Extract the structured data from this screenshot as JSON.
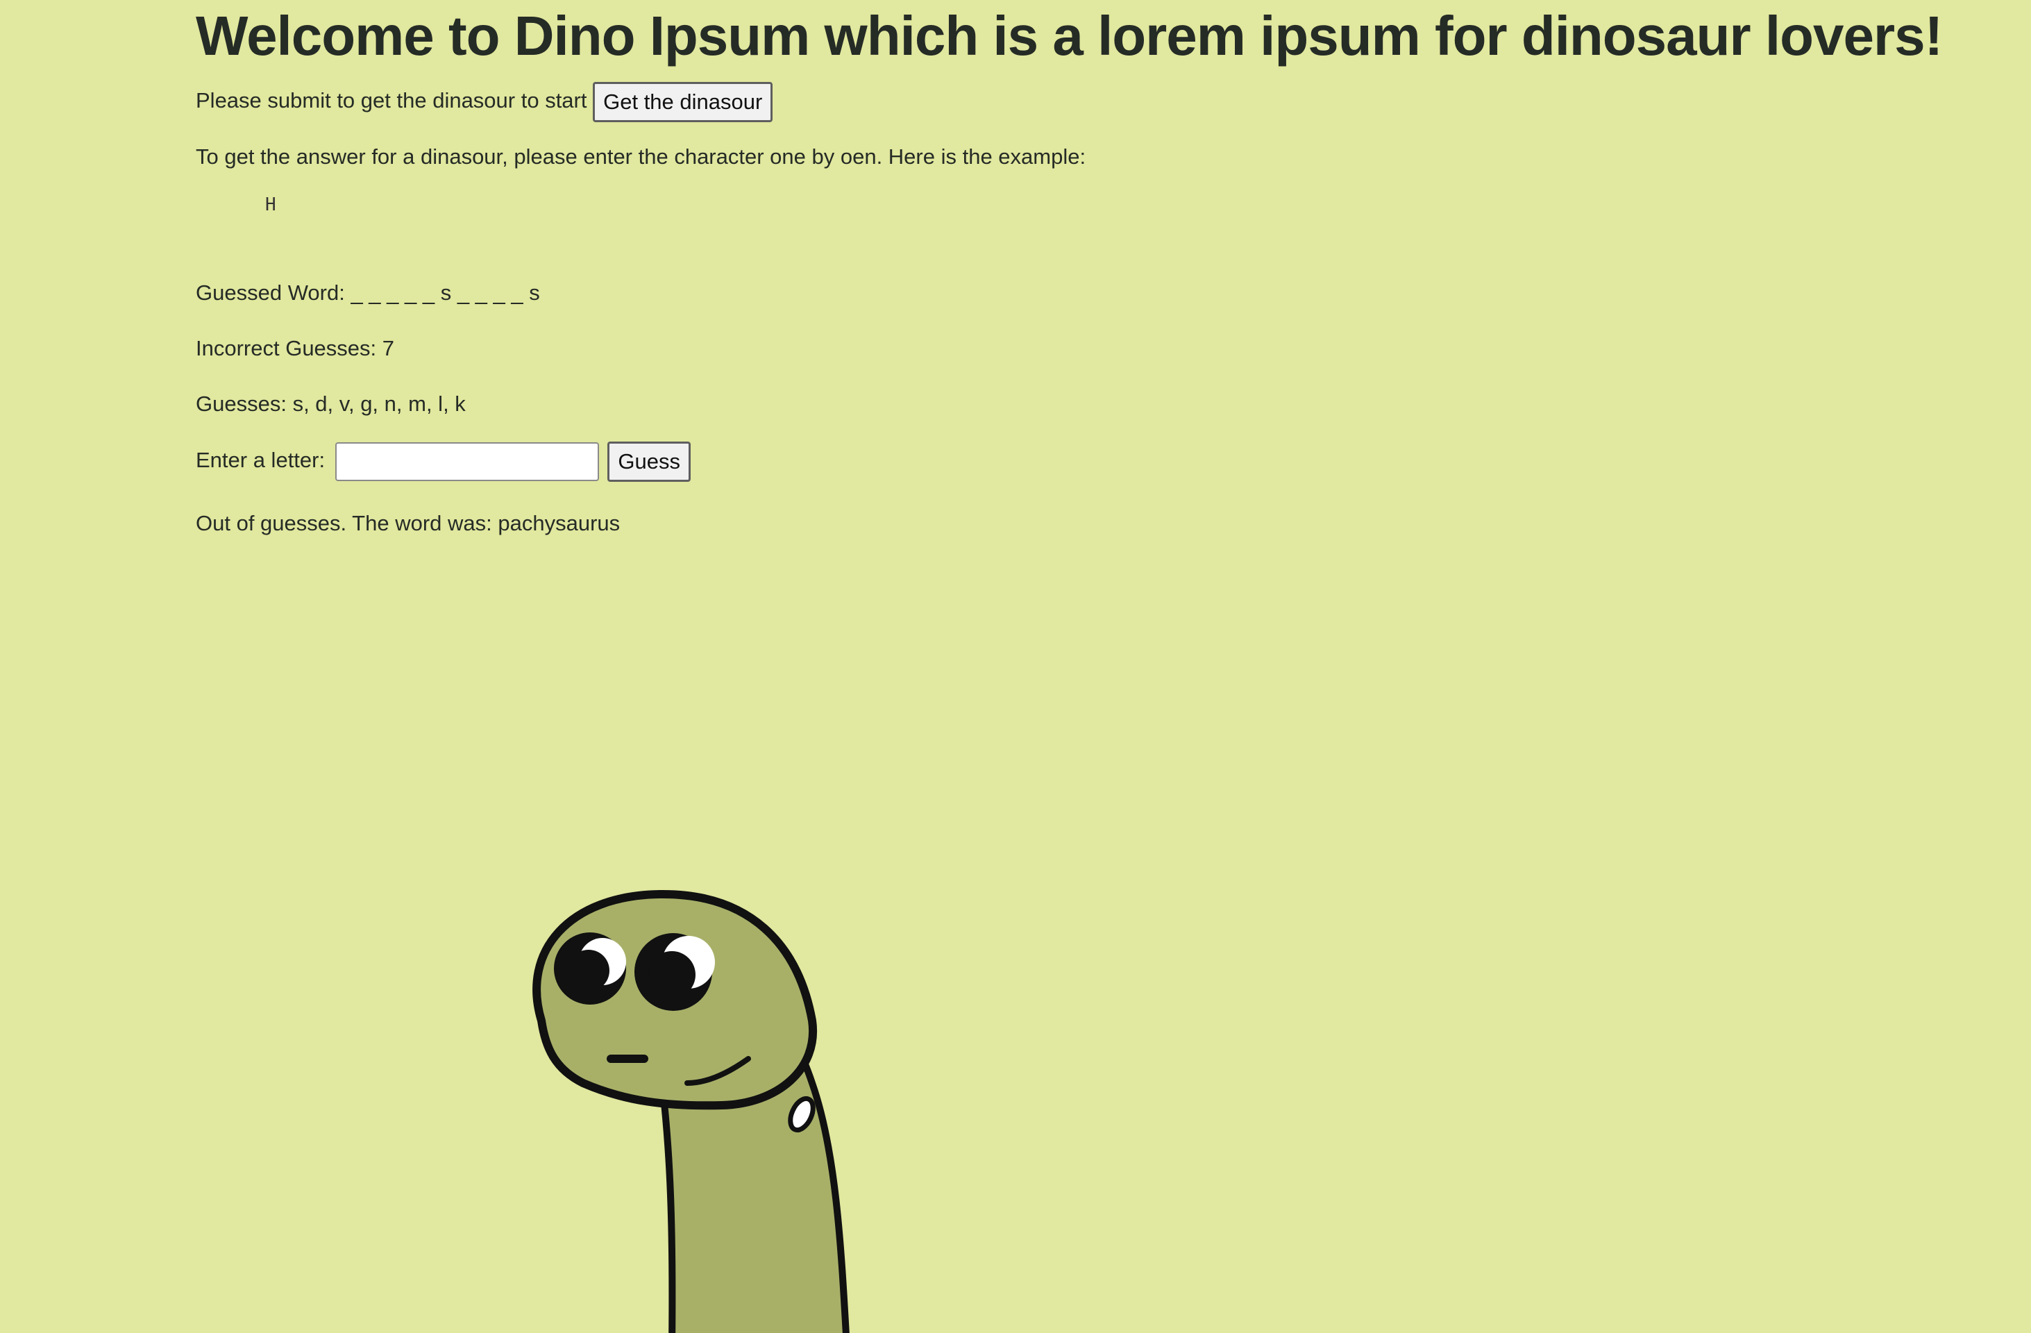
{
  "header": {
    "title": "Welcome to Dino Ipsum which is a lorem ipsum for dinosaur lovers!"
  },
  "start": {
    "prompt": "Please submit to get the dinasour to start",
    "button_label": "Get the dinasour"
  },
  "instructions": {
    "text": "To get the answer for a dinasour, please enter the character one by oen. Here is the example:",
    "example_letter": "H"
  },
  "game": {
    "guessed_word_label": "Guessed Word:",
    "guessed_word_value": "_ _ _ _ _ s _ _ _ _ s",
    "incorrect_label": "Incorrect Guesses:",
    "incorrect_count": "7",
    "guesses_label": "Guesses:",
    "guesses_value": "s, d, v, g, n, m, l, k",
    "enter_label": "Enter a letter:",
    "input_value": "",
    "input_placeholder": "",
    "guess_button_label": "Guess",
    "result_message": "Out of guesses. The word was: pachysaurus"
  },
  "illustration": {
    "icon": "dinosaur-illustration",
    "body_color": "#a8b068",
    "outline_color": "#111111"
  },
  "colors": {
    "background": "#e1e89f",
    "text": "#252b25"
  }
}
